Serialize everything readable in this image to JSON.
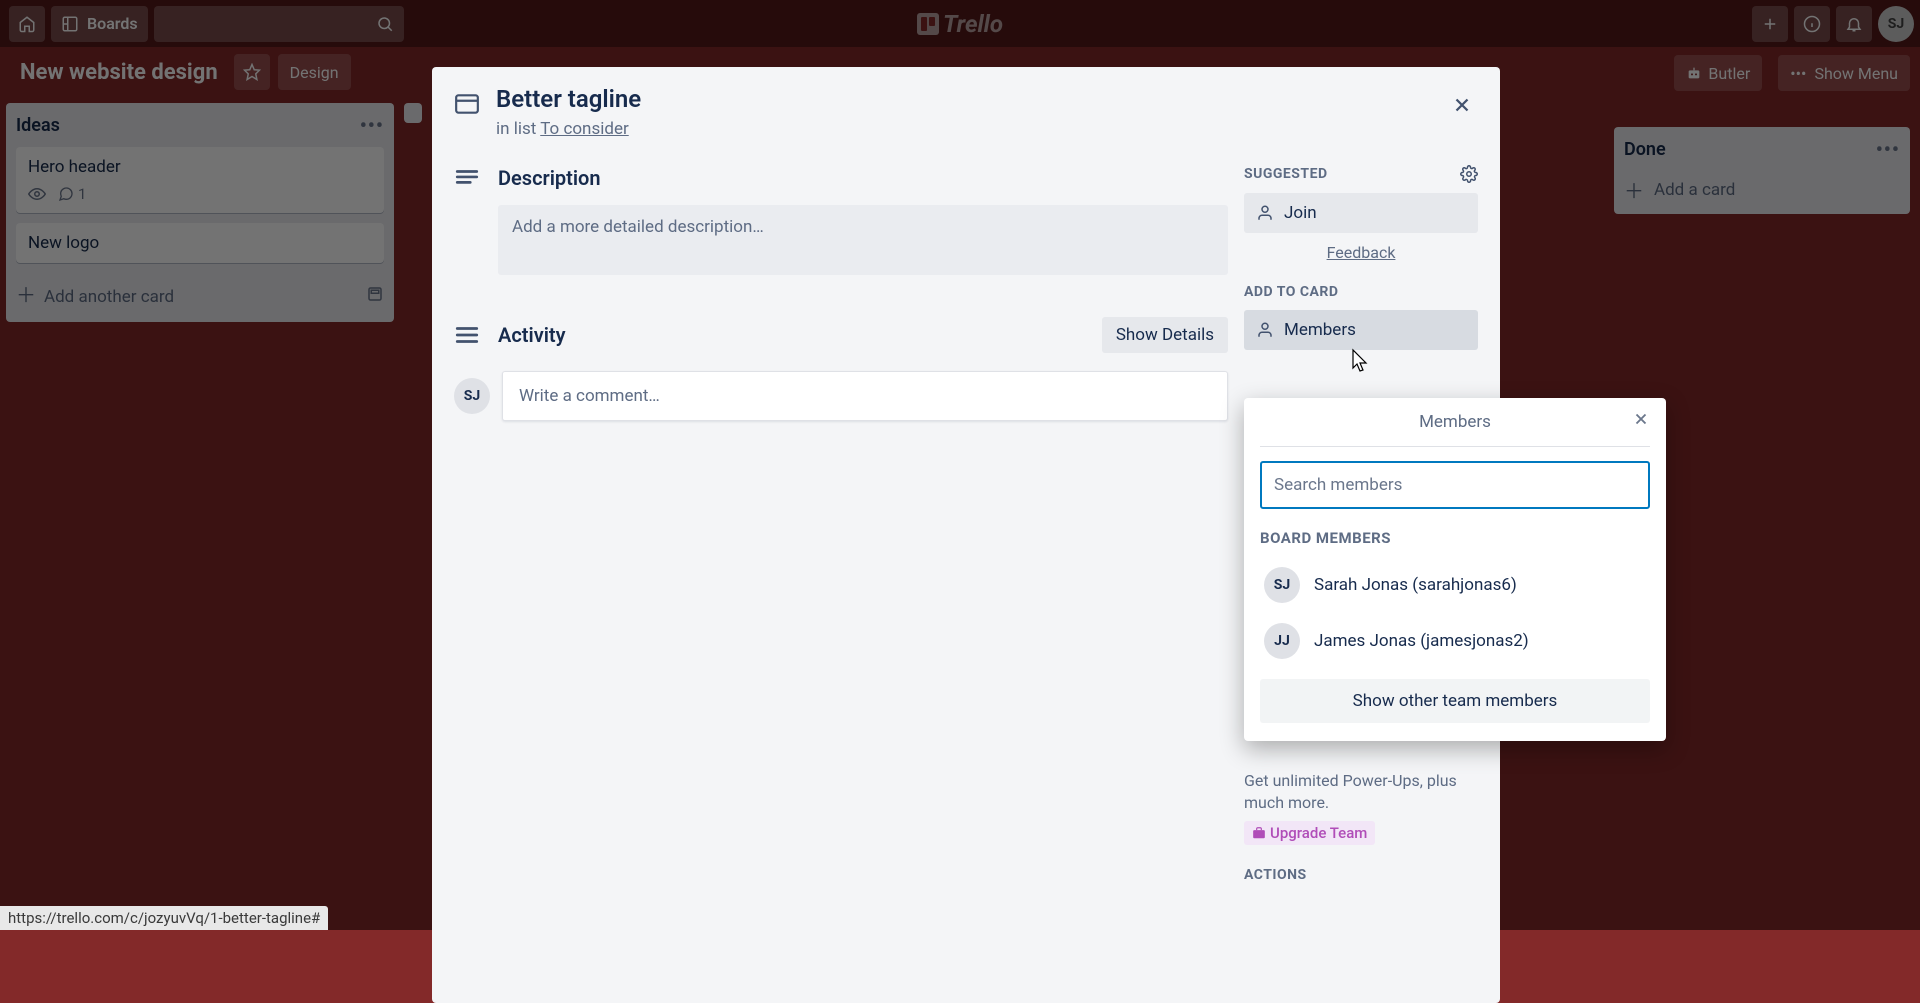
{
  "header": {
    "boards_label": "Boards",
    "logo_text": "Trello",
    "avatar": "SJ"
  },
  "board_bar": {
    "title": "New website design",
    "team_label": "Design",
    "butler_label": "Butler",
    "show_menu_label": "Show Menu"
  },
  "lists": {
    "ideas": {
      "title": "Ideas",
      "cards": [
        {
          "text": "Hero header",
          "comments": "1"
        },
        {
          "text": "New logo"
        }
      ],
      "add_another": "Add another card"
    },
    "done": {
      "title": "Done",
      "add_card": "Add a card"
    }
  },
  "modal": {
    "title": "Better tagline",
    "in_list_prefix": "in list ",
    "in_list_link": "To consider",
    "description_title": "Description",
    "description_placeholder": "Add a more detailed description…",
    "activity_title": "Activity",
    "show_details": "Show Details",
    "avatar": "SJ",
    "comment_placeholder": "Write a comment…",
    "sidebar": {
      "suggested_label": "SUGGESTED",
      "join": "Join",
      "feedback": "Feedback",
      "add_to_card_label": "ADD TO CARD",
      "members": "Members",
      "upsell_text": "Get unlimited Power-Ups, plus much more.",
      "upgrade": "Upgrade Team",
      "actions_label": "ACTIONS"
    }
  },
  "popover": {
    "title": "Members",
    "search_placeholder": "Search members",
    "board_members_label": "BOARD MEMBERS",
    "members": [
      {
        "initials": "SJ",
        "name": "Sarah Jonas (sarahjonas6)"
      },
      {
        "initials": "JJ",
        "name": "James Jonas (jamesjonas2)"
      }
    ],
    "show_other": "Show other team members"
  },
  "status_url": "https://trello.com/c/jozyuvVq/1-better-tagline#"
}
